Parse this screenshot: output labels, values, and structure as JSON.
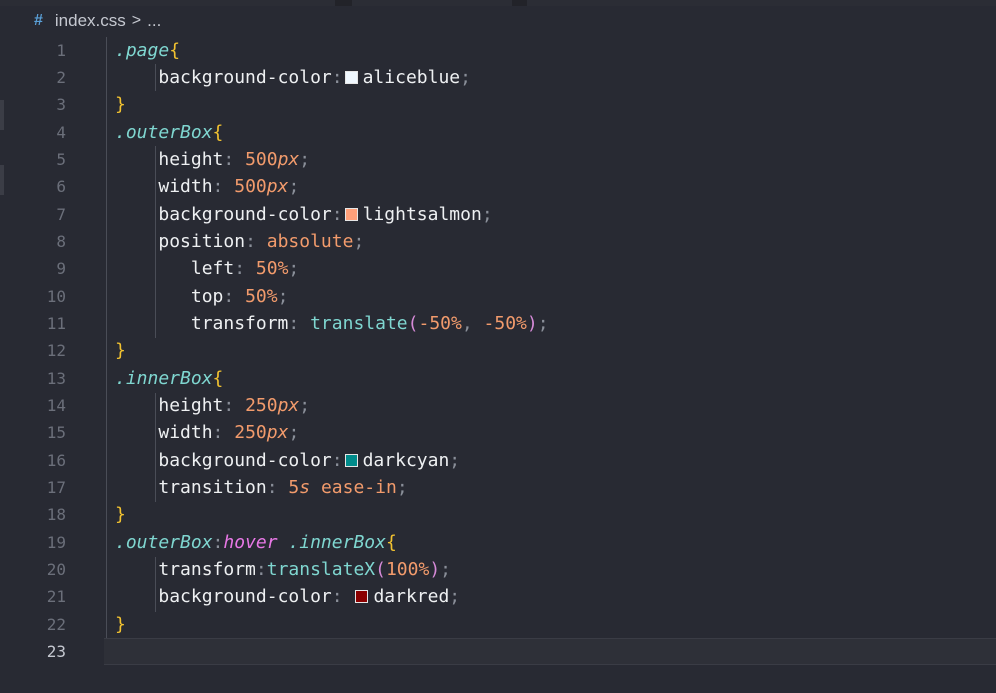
{
  "breadcrumb": {
    "file_icon": "#",
    "file_name": "index.css",
    "separator": ">",
    "more": "..."
  },
  "editor": {
    "line_numbers": [
      "1",
      "2",
      "3",
      "4",
      "5",
      "6",
      "7",
      "8",
      "9",
      "10",
      "11",
      "12",
      "13",
      "14",
      "15",
      "16",
      "17",
      "18",
      "19",
      "20",
      "21",
      "22",
      "23"
    ],
    "current_line": "23",
    "colors": {
      "aliceblue": "#f0f8ff",
      "lightsalmon": "#ffa07a",
      "darkcyan": "#008b8b",
      "darkred": "#8b0000"
    },
    "code": {
      "l1_selector": ".page",
      "open_brace": "{",
      "close_brace": "}",
      "colon": ":",
      "semicolon": ";",
      "comma": ",",
      "lparen": "(",
      "rparen": ")",
      "l2_prop": "background-color",
      "l2_value": "aliceblue",
      "l4_selector": ".outerBox",
      "l5_prop": "height",
      "l5_num": "500",
      "l5_unit": "px",
      "l6_prop": "width",
      "l6_num": "500",
      "l6_unit": "px",
      "l7_prop": "background-color",
      "l7_value": "lightsalmon",
      "l8_prop": "position",
      "l8_value": "absolute",
      "l9_prop": "left",
      "l9_value": "50%",
      "l10_prop": "top",
      "l10_value": "50%",
      "l11_prop": "transform",
      "l11_fn": "translate",
      "l11_arg1": "-50%",
      "l11_arg2": "-50%",
      "l13_selector": ".innerBox",
      "l14_prop": "height",
      "l14_num": "250",
      "l14_unit": "px",
      "l15_prop": "width",
      "l15_num": "250",
      "l15_unit": "px",
      "l16_prop": "background-color",
      "l16_value": "darkcyan",
      "l17_prop": "transition",
      "l17_num": "5",
      "l17_unit": "s",
      "l17_value": "ease-in",
      "l19_selector1": ".outerBox",
      "l19_pseudo": "hover",
      "l19_selector2": ".innerBox",
      "l20_prop": "transform",
      "l20_fn": "translateX",
      "l20_arg": "100%",
      "l21_prop": "background-color",
      "l21_value": "darkred"
    }
  }
}
